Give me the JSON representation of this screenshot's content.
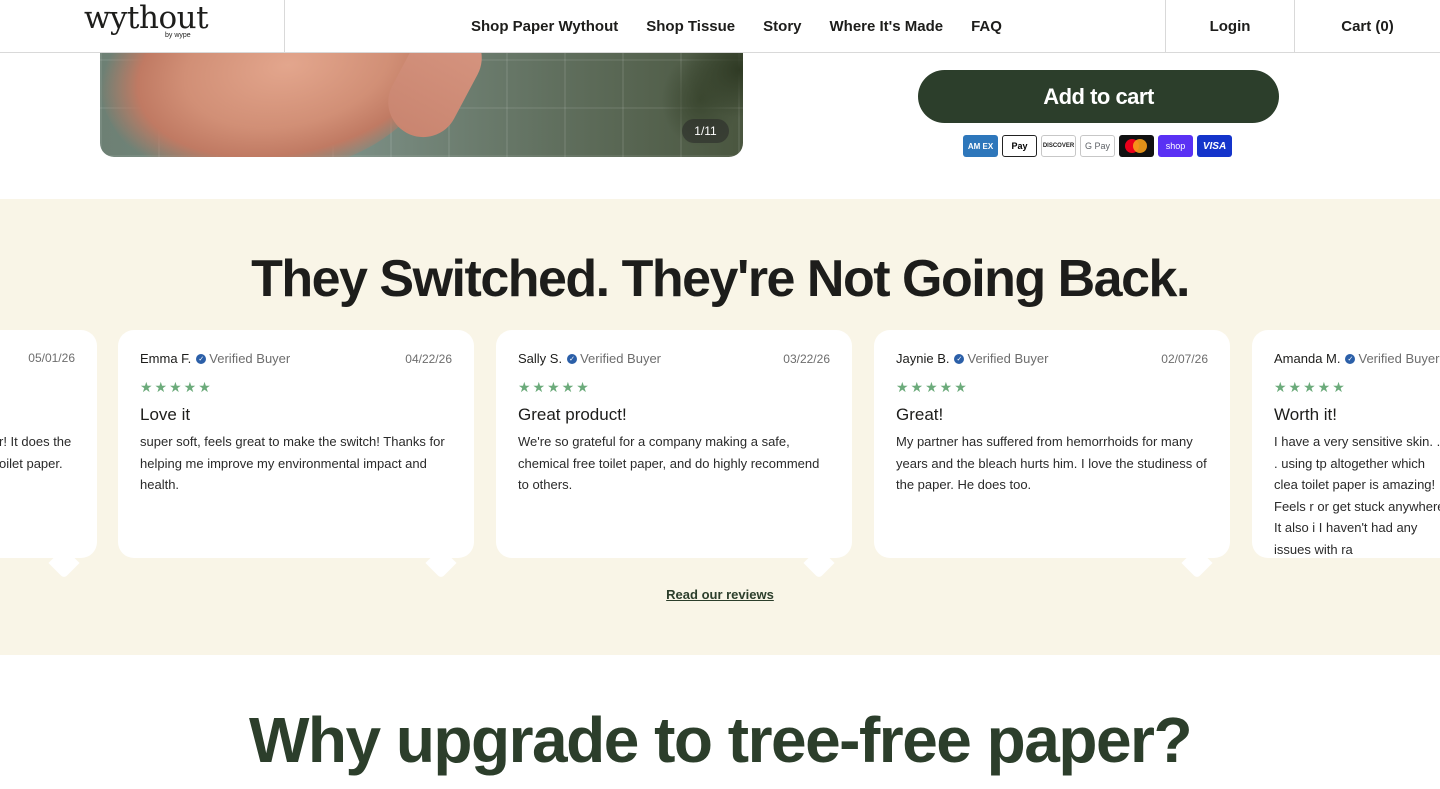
{
  "header": {
    "logo": "wythout",
    "logo_sub": "by wype",
    "nav": [
      "Shop Paper Wythout",
      "Shop Tissue",
      "Story",
      "Where It's Made",
      "FAQ"
    ],
    "login": "Login",
    "cart": "Cart (0)"
  },
  "product": {
    "image_counter": "1/11",
    "add_to_cart": "Add to cart",
    "payment_methods": [
      {
        "name": "amex-icon",
        "label": "AM EX"
      },
      {
        "name": "apple-pay-icon",
        "label": "Pay"
      },
      {
        "name": "discover-icon",
        "label": "DISCOVER"
      },
      {
        "name": "google-pay-icon",
        "label": "G Pay"
      },
      {
        "name": "mastercard-icon",
        "label": ""
      },
      {
        "name": "shop-pay-icon",
        "label": "shop"
      },
      {
        "name": "visa-icon",
        "label": "VISA"
      }
    ]
  },
  "reviews": {
    "title": "They Switched. They're Not Going Back.",
    "verified_label": "Verified Buyer",
    "stars": "★★★★★",
    "items": [
      {
        "name": "",
        "date": "05/01/26",
        "title": "",
        "body": "r! It does the oilet paper."
      },
      {
        "name": "Emma F.",
        "date": "04/22/26",
        "title": "Love it",
        "body": "super soft, feels great to make the switch! Thanks for helping me improve my environmental impact and health."
      },
      {
        "name": "Sally S.",
        "date": "03/22/26",
        "title": "Great product!",
        "body": "We're so grateful for a company making a safe, chemical free toilet paper, and do highly recommend to others."
      },
      {
        "name": "Jaynie B.",
        "date": "02/07/26",
        "title": "Great!",
        "body": "My partner has suffered from hemorrhoids for many years and the bleach hurts him. I love the studiness of the paper. He does too."
      },
      {
        "name": "Amanda M.",
        "date": "",
        "title": "Worth it!",
        "body": "I have a very sensitive skin. . . . using tp altogether which clea toilet paper is amazing! Feels r or get stuck anywhere! It also i I haven't had any issues with ra"
      }
    ],
    "read_link": "Read our reviews"
  },
  "upgrade": {
    "title": "Why upgrade to tree-free paper?"
  },
  "colors": {
    "brand_green": "#2c3e2b",
    "reviews_bg": "#f9f5e7",
    "star_green": "#6cab7b"
  }
}
